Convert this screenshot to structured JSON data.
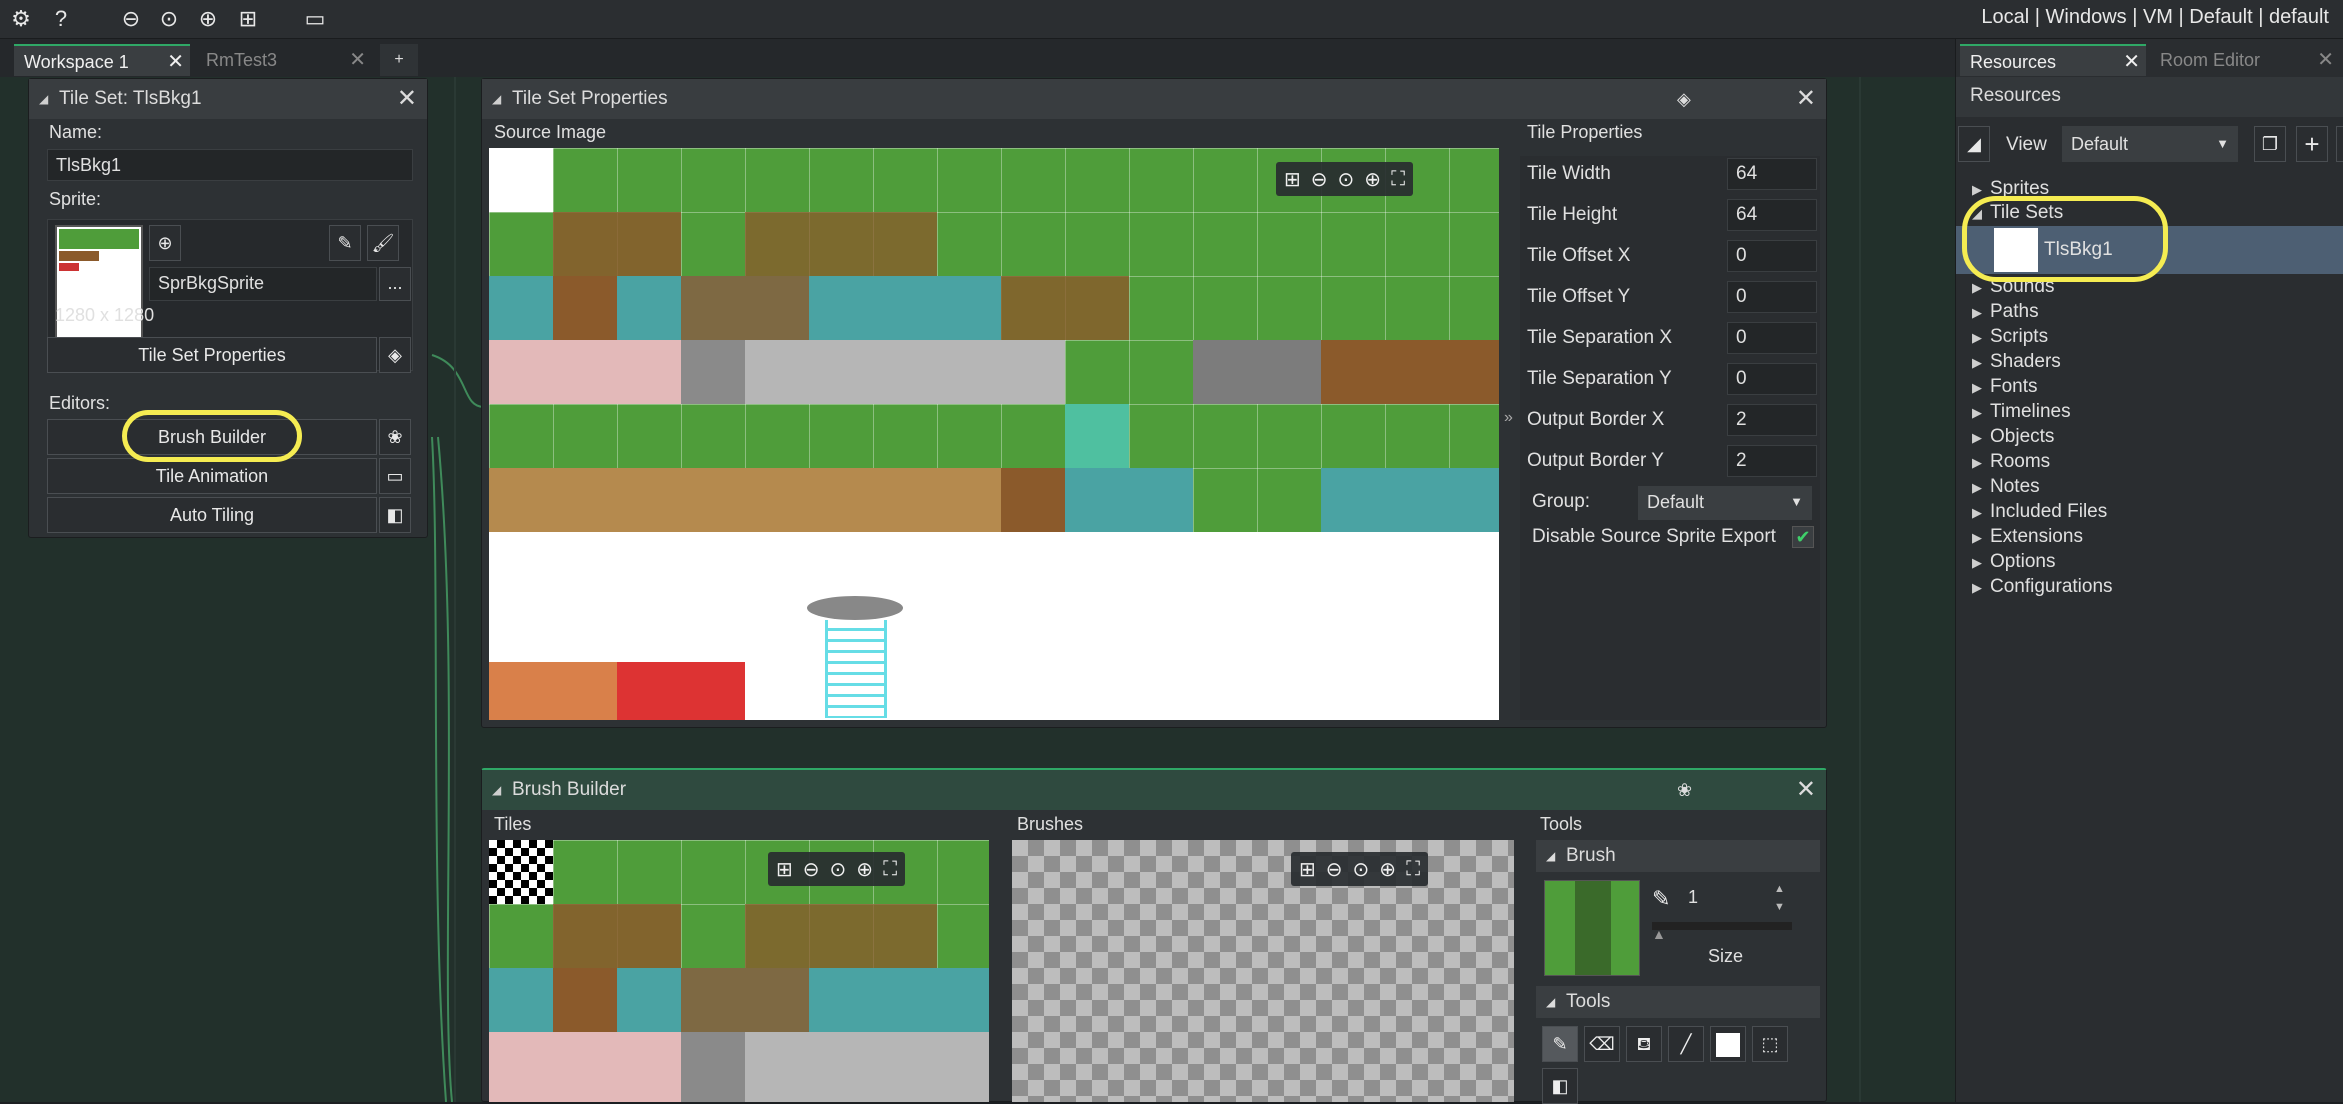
{
  "topbar": {
    "target": "Local | Windows | VM | Default | default"
  },
  "tabs": [
    {
      "label": "Workspace 1"
    },
    {
      "label": "RmTest3"
    }
  ],
  "tileset_panel": {
    "title": "Tile Set: TlsBkg1",
    "name_label": "Name:",
    "name_value": "TlsBkg1",
    "sprite_label": "Sprite:",
    "sprite_name": "SprBkgSprite",
    "sprite_more": "...",
    "dimensions": "1280 x 1280",
    "properties_button": "Tile Set Properties",
    "editors_label": "Editors:",
    "editors": [
      {
        "label": "Brush Builder"
      },
      {
        "label": "Tile Animation"
      },
      {
        "label": "Auto Tiling"
      }
    ]
  },
  "props_panel": {
    "title": "Tile Set Properties",
    "source_image_label": "Source Image",
    "tile_properties_label": "Tile Properties",
    "rows": [
      {
        "label": "Tile Width",
        "value": "64"
      },
      {
        "label": "Tile Height",
        "value": "64"
      },
      {
        "label": "Tile Offset X",
        "value": "0"
      },
      {
        "label": "Tile Offset Y",
        "value": "0"
      },
      {
        "label": "Tile Separation X",
        "value": "0"
      },
      {
        "label": "Tile Separation Y",
        "value": "0"
      },
      {
        "label": "Output Border X",
        "value": "2"
      },
      {
        "label": "Output Border Y",
        "value": "2"
      }
    ],
    "group_label": "Group:",
    "group_value": "Default",
    "disable_export_label": "Disable Source Sprite Export",
    "disable_export_checked": true
  },
  "brush_panel": {
    "title": "Brush Builder",
    "tiles_label": "Tiles",
    "brushes_label": "Brushes",
    "tools_label": "Tools",
    "brush_section": "Brush",
    "brush_size_value": "1",
    "size_label": "Size",
    "tools_section": "Tools"
  },
  "resources": {
    "tab_resources": "Resources",
    "tab_room_editor": "Room Editor",
    "header": "Resources",
    "view_label": "View",
    "view_value": "Default",
    "tree": [
      {
        "label": "Sprites"
      },
      {
        "label": "Tile Sets"
      },
      {
        "label": "TlsBkg1"
      },
      {
        "label": "Sounds"
      },
      {
        "label": "Paths"
      },
      {
        "label": "Scripts"
      },
      {
        "label": "Shaders"
      },
      {
        "label": "Fonts"
      },
      {
        "label": "Timelines"
      },
      {
        "label": "Objects"
      },
      {
        "label": "Rooms"
      },
      {
        "label": "Notes"
      },
      {
        "label": "Included Files"
      },
      {
        "label": "Extensions"
      },
      {
        "label": "Options"
      },
      {
        "label": "Configurations"
      }
    ]
  }
}
